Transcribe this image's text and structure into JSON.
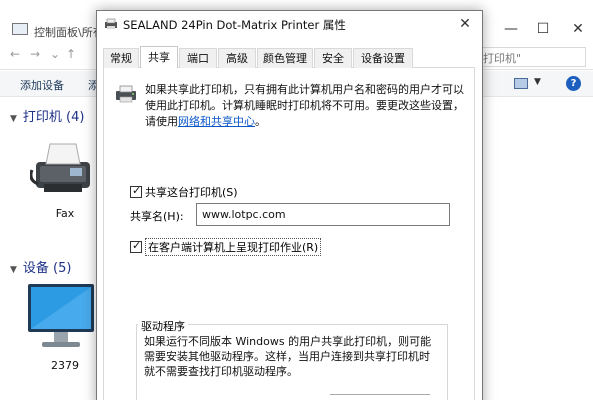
{
  "background_window": {
    "title": "控制面板\\所有",
    "search_placeholder": "打印机\"",
    "commands": {
      "add_device": "添加设备",
      "add_printer_partial": "添"
    },
    "groups": {
      "printers": "打印机 (4)",
      "devices": "设备 (5)"
    },
    "items": {
      "fax": "Fax",
      "monitor": "2379"
    },
    "help_glyph": "?"
  },
  "dialog": {
    "title": "SEALAND 24Pin Dot-Matrix Printer 属性",
    "tabs": [
      "常规",
      "共享",
      "端口",
      "高级",
      "颜色管理",
      "安全",
      "设备设置"
    ],
    "active_tab_index": 1,
    "info": {
      "text": "如果共享此打印机，只有拥有此计算机用户名和密码的用户才可以使用此打印机。计算机睡眠时打印机将不可用。要更改这些设置，请使用",
      "link": "网络和共享中心",
      "suffix": "。"
    },
    "share_checkbox": {
      "label": "共享这台打印机(S)",
      "checked": true
    },
    "share_name": {
      "label": "共享名(H):",
      "value": "www.lotpc.com"
    },
    "render_checkbox": {
      "label": "在客户端计算机上呈现打印作业(R)",
      "checked": true
    },
    "drivers": {
      "title": "驱动程序",
      "text": "如果运行不同版本 Windows 的用户共享此打印机，则可能需要安装其他驱动程序。这样，当用户连接到共享打印机时就不需要查找打印机驱动程序。"
    }
  },
  "colors": {
    "link": "#0a58c8",
    "group_header": "#1e3287",
    "help": "#1d5fbf"
  }
}
